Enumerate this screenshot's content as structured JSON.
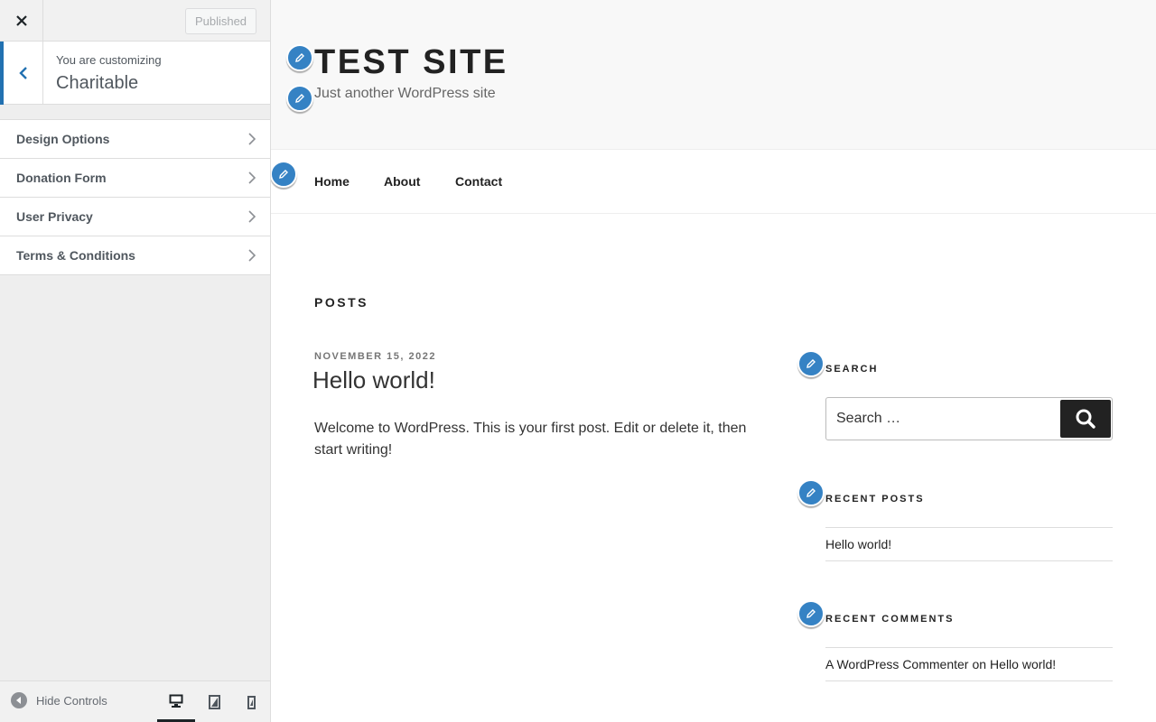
{
  "customizer": {
    "close_icon": "close-icon",
    "publish_label": "Published",
    "customizing_label": "You are customizing",
    "theme_name": "Charitable",
    "sections": [
      {
        "label": "Design Options"
      },
      {
        "label": "Donation Form"
      },
      {
        "label": "User Privacy"
      },
      {
        "label": "Terms & Conditions"
      }
    ],
    "footer": {
      "hide_controls_label": "Hide Controls",
      "devices": [
        "desktop",
        "tablet",
        "mobile"
      ],
      "active_device": "desktop"
    },
    "accent_color": "#2271b1"
  },
  "site": {
    "title": "TEST SITE",
    "tagline": "Just another WordPress site",
    "nav": [
      "Home",
      "About",
      "Contact"
    ],
    "posts_heading": "POSTS",
    "post": {
      "date": "NOVEMBER 15, 2022",
      "title": "Hello world!",
      "excerpt": "Welcome to WordPress. This is your first post. Edit or delete it, then start writing!"
    },
    "widgets": {
      "search": {
        "title": "SEARCH",
        "placeholder": "Search …"
      },
      "recent_posts": {
        "title": "RECENT POSTS",
        "items": [
          "Hello world!"
        ]
      },
      "recent_comments": {
        "title": "RECENT COMMENTS",
        "author": "A WordPress Commenter",
        "connector": "on",
        "post": "Hello world!"
      }
    },
    "edit_shortcut_color": "#3582c4"
  }
}
